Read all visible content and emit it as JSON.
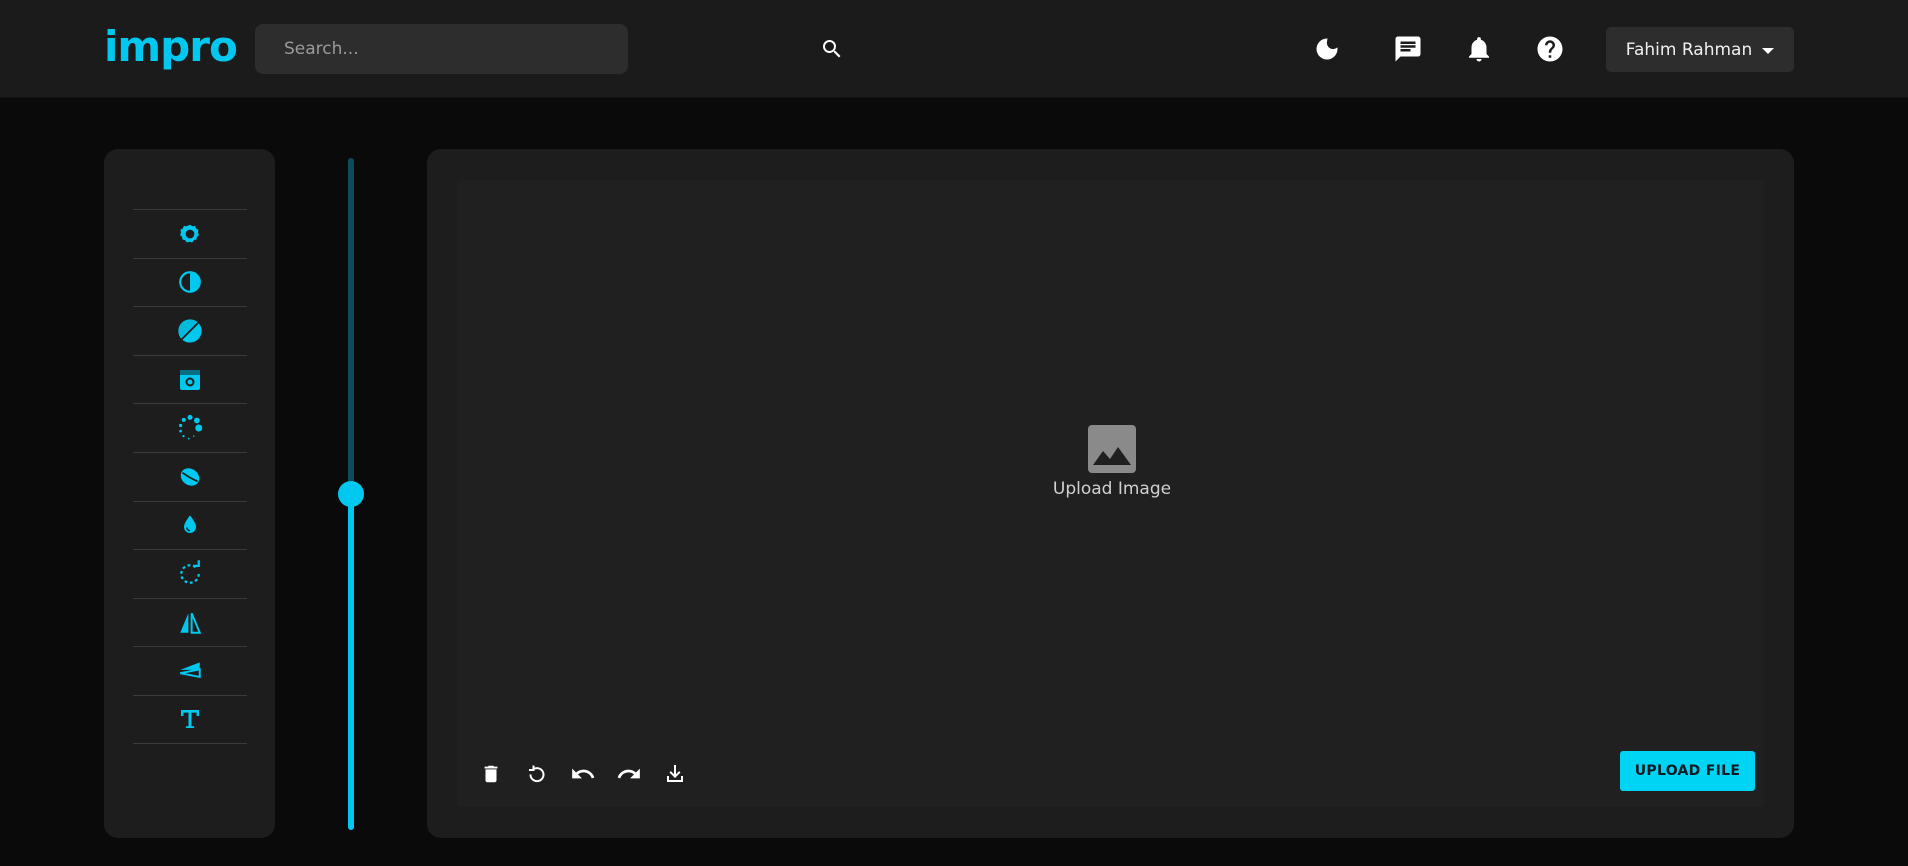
{
  "header": {
    "logo": "impro",
    "search": {
      "placeholder": "Search..."
    },
    "icons": [
      "moon-icon",
      "chat-icon",
      "bell-icon",
      "help-icon"
    ],
    "user": {
      "name": "Fahim Rahman"
    }
  },
  "tools": [
    "brightness-icon",
    "contrast-icon",
    "saturation-icon",
    "exposure-icon",
    "blur-icon",
    "hue-icon",
    "color-drop-icon",
    "rotate-icon",
    "flip-horizontal-icon",
    "flip-vertical-icon",
    "text-icon"
  ],
  "slider": {
    "value_fraction": 0.5
  },
  "editor": {
    "upload_label": "Upload Image",
    "upload_button": "UPLOAD FILE",
    "actions": [
      "delete-icon",
      "reset-icon",
      "undo-icon",
      "redo-icon",
      "download-icon"
    ]
  },
  "colors": {
    "accent": "#00c8ee",
    "background": "#0a0a0a",
    "panel": "#1d1d1d",
    "topbar": "#1b1b1b"
  }
}
